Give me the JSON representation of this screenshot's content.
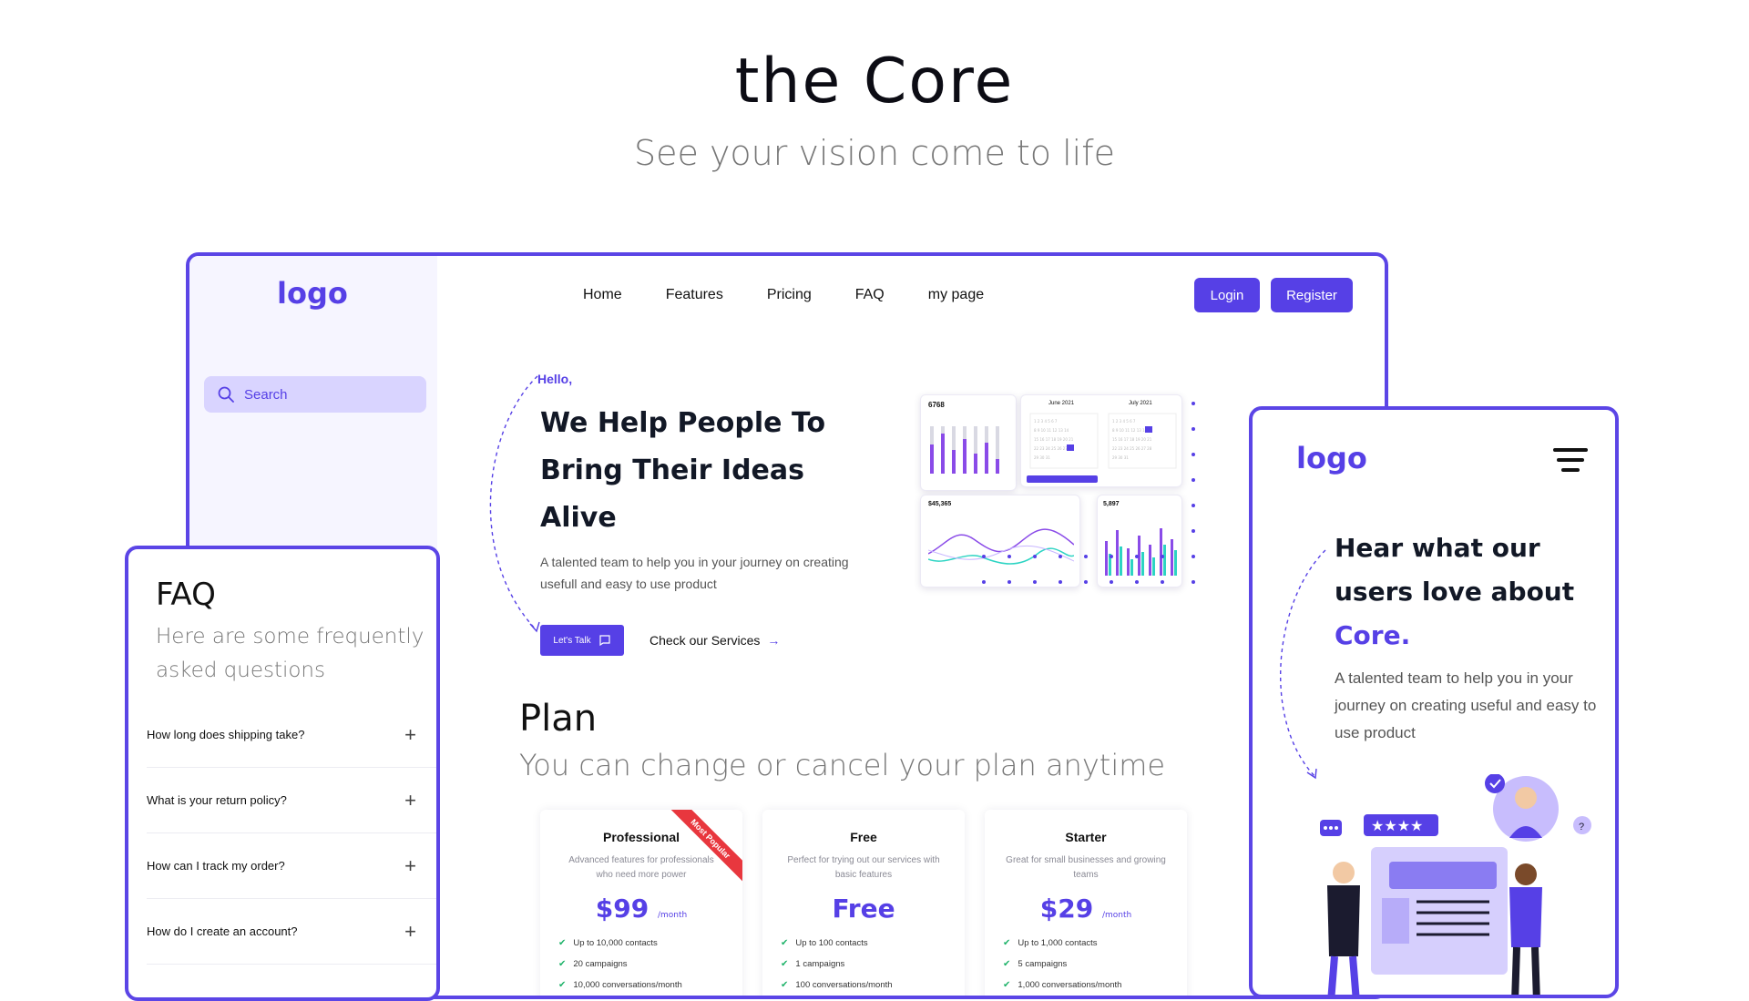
{
  "hero": {
    "title": "the Core",
    "subtitle": "See your vision come to life"
  },
  "desktop": {
    "logo": "logo",
    "search": {
      "placeholder": "Search"
    },
    "nav": [
      "Home",
      "Features",
      "Pricing",
      "FAQ",
      "my page"
    ],
    "login_label": "Login",
    "register_label": "Register",
    "hello": "Hello,",
    "headline": "We Help People To Bring Their Ideas Alive",
    "description": "A talented team to help you in your journey on creating usefull and easy to use product",
    "talk_button": "Let's Talk",
    "services_link": "Check our Services",
    "dashboard": {
      "card1_value": "6768",
      "card2_month": "June 2021",
      "card3_month": "July 2021",
      "card4_value": "$45,365",
      "card5_value": "5,897"
    },
    "plan": {
      "title": "Plan",
      "subtitle": "You can change or cancel your plan anytime",
      "cards": [
        {
          "name": "Professional",
          "desc": "Advanced features for professionals who need more power",
          "price": "$99",
          "per": "/month",
          "ribbon": "Most Popular",
          "features": [
            "Up to 10,000 contacts",
            "20 campaigns",
            "10,000 conversations/month"
          ]
        },
        {
          "name": "Free",
          "desc": "Perfect for trying out our services with basic features",
          "price": "Free",
          "per": "",
          "ribbon": "",
          "features": [
            "Up to 100 contacts",
            "1 campaigns",
            "100 conversations/month"
          ]
        },
        {
          "name": "Starter",
          "desc": "Great for small businesses and growing teams",
          "price": "$29",
          "per": "/month",
          "ribbon": "",
          "features": [
            "Up to 1,000 contacts",
            "5 campaigns",
            "1,000 conversations/month"
          ]
        }
      ]
    }
  },
  "faq": {
    "title": "FAQ",
    "subtitle": "Here are some frequently asked questions",
    "items": [
      "How long does shipping take?",
      "What is your return policy?",
      "How can I track my order?",
      "How do I create an account?"
    ]
  },
  "testimonials": {
    "logo": "logo",
    "headline_main": "Hear what our users love about",
    "headline_accent": "Core.",
    "description": "A talented team to help you in your journey on creating useful and easy to use product"
  },
  "colors": {
    "brand": "#5640e6",
    "ribbon": "#e8373e",
    "check": "#1fb36a"
  }
}
